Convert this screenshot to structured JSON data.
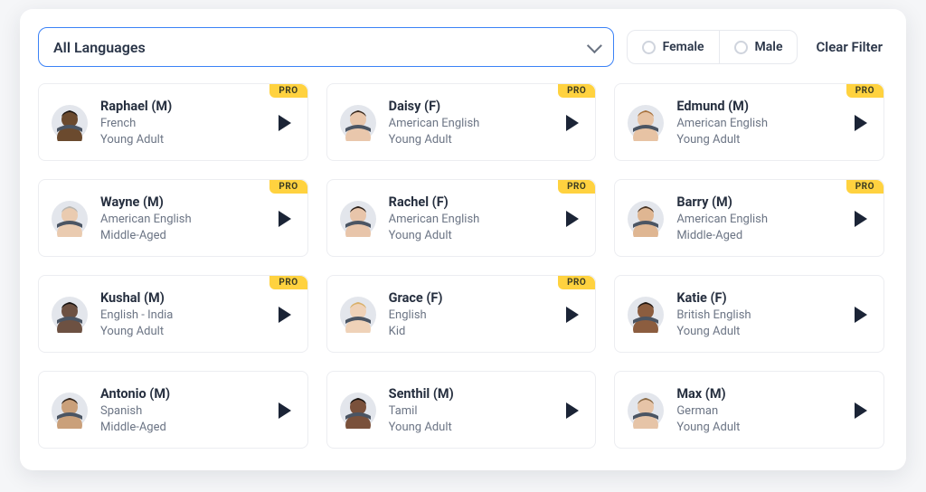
{
  "filters": {
    "language_label": "All Languages",
    "female_label": "Female",
    "male_label": "Male",
    "clear_label": "Clear Filter"
  },
  "pro_label": "PRO",
  "voices": [
    {
      "name": "Raphael (M)",
      "language": "French",
      "age": "Young Adult",
      "pro": true,
      "skin": "#6b4a2e",
      "hair": "#1c1510"
    },
    {
      "name": "Daisy (F)",
      "language": "American English",
      "age": "Young Adult",
      "pro": true,
      "skin": "#e9c7ac",
      "hair": "#3a2a1e"
    },
    {
      "name": "Edmund (M)",
      "language": "American English",
      "age": "Young Adult",
      "pro": true,
      "skin": "#e7c3a4",
      "hair": "#a8723e"
    },
    {
      "name": "Wayne (M)",
      "language": "American English",
      "age": "Middle-Aged",
      "pro": true,
      "skin": "#eacbb0",
      "hair": "#b8b6b1"
    },
    {
      "name": "Rachel (F)",
      "language": "American English",
      "age": "Young Adult",
      "pro": true,
      "skin": "#e8c5aa",
      "hair": "#2e221a"
    },
    {
      "name": "Barry (M)",
      "language": "American English",
      "age": "Middle-Aged",
      "pro": true,
      "skin": "#dfb692",
      "hair": "#4a3524"
    },
    {
      "name": "Kushal (M)",
      "language": "English - India",
      "age": "Young Adult",
      "pro": true,
      "skin": "#6d5142",
      "hair": "#171311"
    },
    {
      "name": "Grace (F)",
      "language": "English",
      "age": "Kid",
      "pro": true,
      "skin": "#efd2b8",
      "hair": "#d9b06a"
    },
    {
      "name": "Katie (F)",
      "language": "British English",
      "age": "Young Adult",
      "pro": false,
      "skin": "#8c5d3f",
      "hair": "#221812"
    },
    {
      "name": "Antonio (M)",
      "language": "Spanish",
      "age": "Middle-Aged",
      "pro": false,
      "skin": "#caa07a",
      "hair": "#2c2018"
    },
    {
      "name": "Senthil (M)",
      "language": "Tamil",
      "age": "Young Adult",
      "pro": false,
      "skin": "#7a513b",
      "hair": "#15110e"
    },
    {
      "name": "Max (M)",
      "language": "German",
      "age": "Young Adult",
      "pro": false,
      "skin": "#e6c4a7",
      "hair": "#8a6a45"
    }
  ]
}
